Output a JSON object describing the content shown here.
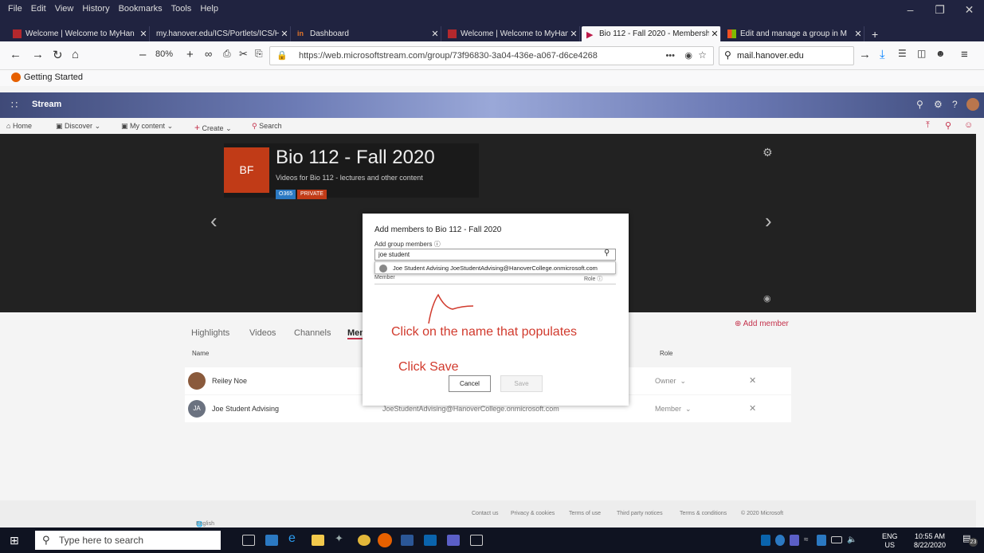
{
  "browser": {
    "menu": [
      "File",
      "Edit",
      "View",
      "History",
      "Bookmarks",
      "Tools",
      "Help"
    ],
    "tabs": [
      {
        "title": "Welcome | Welcome to MyHan",
        "active": false
      },
      {
        "title": "my.hanover.edu/ICS/Portlets/ICS/H",
        "active": false
      },
      {
        "title": "Dashboard",
        "active": false
      },
      {
        "title": "Welcome | Welcome to MyHan",
        "active": false
      },
      {
        "title": "Bio 112 - Fall 2020 - Membersh",
        "active": true
      },
      {
        "title": "Edit and manage a group in M",
        "active": false
      }
    ],
    "new_tab": "+",
    "zoom": "80%",
    "url": "https://web.microsoftstream.com/group/73f96830-3a04-436e-a067-d6ce4268",
    "url_more": "•••",
    "search_value": "mail.hanover.edu",
    "bookmark": "Getting Started"
  },
  "stream": {
    "app_name": "Stream",
    "nav": {
      "home": "Home",
      "discover": "Discover",
      "my_content": "My content",
      "create": "Create",
      "search": "Search"
    },
    "group": {
      "initials": "BF",
      "title": "Bio 112 - Fall 2020",
      "description": "Videos for Bio 112 - lectures and other content",
      "badge_o365": "O365",
      "badge_private": "PRIVATE"
    },
    "tabs": [
      "Highlights",
      "Videos",
      "Channels",
      "Mem"
    ],
    "add_member": "Add member",
    "table": {
      "col_name": "Name",
      "col_role": "Role",
      "rows": [
        {
          "name": "Reiley Noe",
          "email": "",
          "role": "Owner",
          "initials": ""
        },
        {
          "name": "Joe Student Advising",
          "email": "JoeStudentAdvising@HanoverCollege.onmicrosoft.com",
          "role": "Member",
          "initials": "JA"
        }
      ]
    },
    "footer": {
      "language": "English",
      "contact": "Contact us",
      "privacy": "Privacy & cookies",
      "terms": "Terms of use",
      "third_party": "Third party notices",
      "conditions": "Terms & conditions",
      "copyright": "© 2020 Microsoft"
    }
  },
  "modal": {
    "title": "Add members to Bio 112 - Fall 2020",
    "label": "Add group members",
    "input_value": "joe student",
    "suggestion": "Joe Student Advising JoeStudentAdvising@HanoverCollege.onmicrosoft.com",
    "col_member": "Member",
    "col_role": "Role",
    "cancel": "Cancel",
    "save": "Save"
  },
  "annotations": {
    "click_name": "Click on the name that populates",
    "click_save": "Click Save"
  },
  "taskbar": {
    "search_placeholder": "Type here to search",
    "lang_line1": "ENG",
    "lang_line2": "US",
    "time": "10:55 AM",
    "date": "8/22/2020",
    "notif_count": "23"
  },
  "colors": {
    "accent": "#c4314b",
    "group_tile": "#c13b17",
    "annotation": "#d13a2d"
  }
}
